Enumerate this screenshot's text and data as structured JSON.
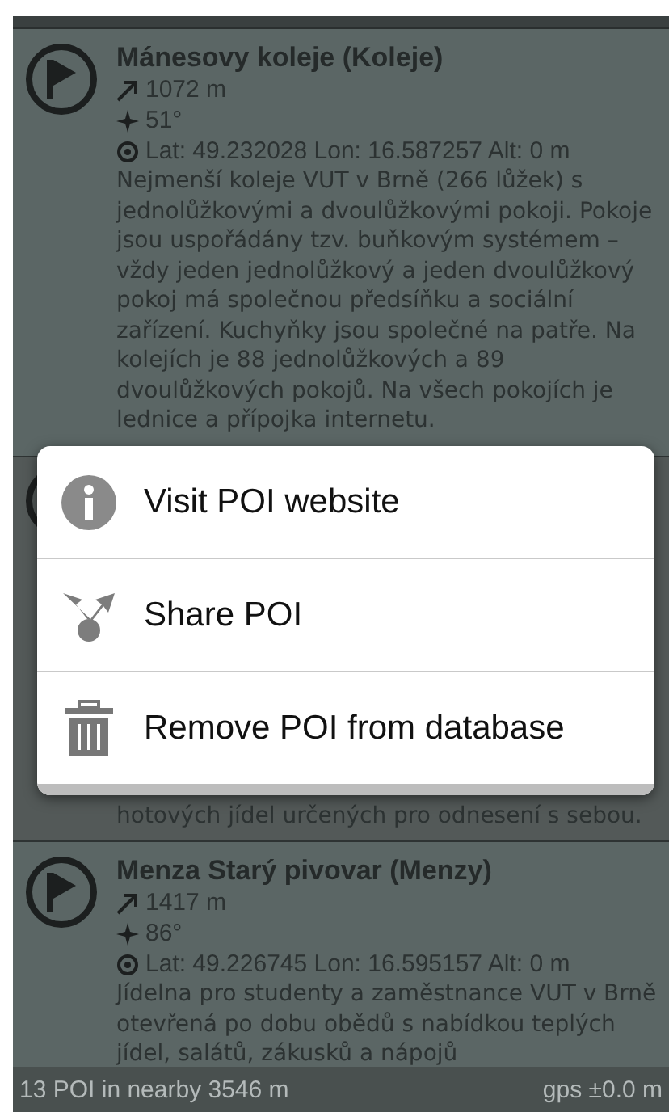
{
  "pois": [
    {
      "title": "Mánesovy koleje (Koleje)",
      "distance": "1072 m",
      "bearing": "51°",
      "coords": "Lat: 49.232028 Lon: 16.587257 Alt: 0 m",
      "description": "Nejmenší koleje VUT v Brně (266 lůžek) s jednolůžkovými a dvoulůžkovými pokoji. Pokoje jsou uspořádány tzv. buňkovým systémem – vždy jeden jednolůžkový a jeden dvoulůžkový pokoj má společnou předsíňku a sociální zařízení. Kuchyňky jsou společné na patře. Na kolejích je 88 jednolůžkových a 89 dvoulůžkových pokojů. Na všech pokojích je lednice a přípojka internetu."
    },
    {
      "description": "hotových jídel určených pro odnesení s sebou."
    },
    {
      "title": "Menza Starý pivovar (Menzy)",
      "distance": "1417 m",
      "bearing": "86°",
      "coords": "Lat: 49.226745 Lon: 16.595157 Alt: 0 m",
      "description": "Jídelna pro studenty a zaměstnance VUT v Brně otevřená po dobu obědů s nabídkou teplých jídel, salátů, zákusků a nápojů"
    }
  ],
  "menu": {
    "items": [
      {
        "label": "Visit POI website",
        "kind": "info"
      },
      {
        "label": "Share POI",
        "kind": "share"
      },
      {
        "label": "Remove POI from database",
        "kind": "trash"
      }
    ]
  },
  "status_bar": {
    "left": "13 POI in nearby 3546 m",
    "right": "gps ±0.0 m"
  }
}
